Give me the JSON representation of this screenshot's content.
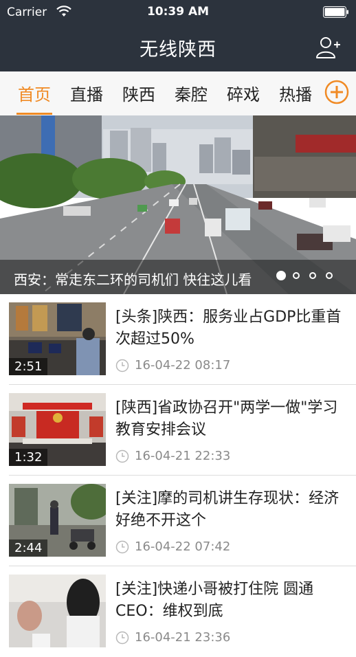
{
  "status_bar": {
    "carrier": "Carrier",
    "time": "10:39 AM"
  },
  "nav": {
    "title": "无线陕西",
    "add_user_icon": "add-user-icon"
  },
  "tabs": [
    {
      "label": "首页",
      "active": true
    },
    {
      "label": "直播"
    },
    {
      "label": "陕西"
    },
    {
      "label": "秦腔"
    },
    {
      "label": "碎戏"
    },
    {
      "label": "热播"
    }
  ],
  "accent_color": "#f08a24",
  "hero": {
    "caption": "西安：常走东二环的司机们 快往这儿看",
    "pages": 4,
    "active_page": 1
  },
  "news": [
    {
      "headline": "[头条]陕西：服务业占GDP比重首次超过50%",
      "time": "16-04-22 08:17",
      "duration": "2:51"
    },
    {
      "headline": "[陕西]省政协召开\"两学一做\"学习教育安排会议",
      "time": "16-04-21 22:33",
      "duration": "1:32"
    },
    {
      "headline": "[关注]摩的司机讲生存现状：经济好绝不开这个",
      "time": "16-04-22 07:42",
      "duration": "2:44"
    },
    {
      "headline": "[关注]快递小哥被打住院 圆通CEO：维权到底",
      "time": "16-04-21 23:36",
      "duration": ""
    }
  ]
}
